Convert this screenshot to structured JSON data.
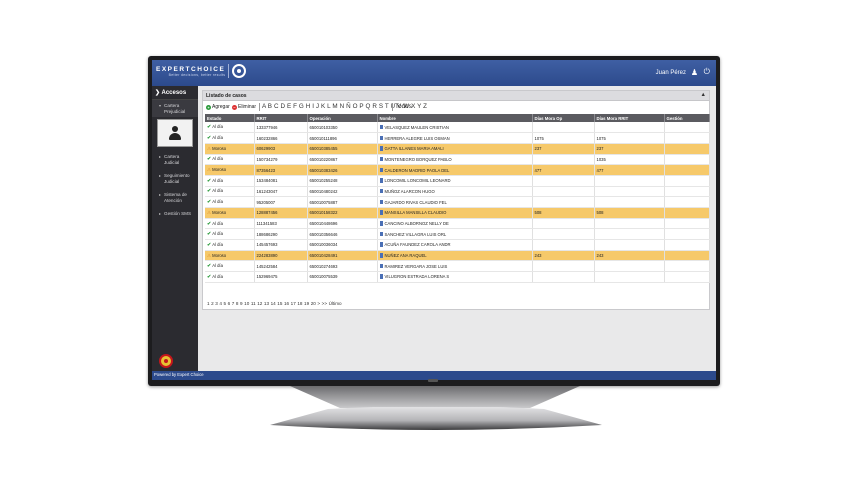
{
  "app": {
    "logo_text": "EXPERTCHOICE",
    "logo_sub": "Better decisions, better results",
    "user_name": "Juan Pérez"
  },
  "sidebar": {
    "header": "Accesos",
    "items": [
      {
        "label": "Cartera Prejudicial",
        "active": true
      },
      {
        "label": "Cartera Judicial",
        "active": false
      },
      {
        "label": "Seguimiento Judicial",
        "active": false
      },
      {
        "label": "Sistema de Atención",
        "active": false
      },
      {
        "label": "Gestión SMS",
        "active": false
      }
    ]
  },
  "footer": {
    "text": "Powered by Expert Choice"
  },
  "panel": {
    "title": "Listado de casos",
    "add_label": "Agregar",
    "delete_label": "Eliminar",
    "alphabet": "A B C D E F G H I J K L M N Ñ O P Q R S T U V W X Y Z",
    "all_label": "Todos"
  },
  "table": {
    "columns": [
      "Estado",
      "RRIT",
      "Operación",
      "Nombre",
      "Días Mora Op",
      "Días Mora RRIT",
      "Gestión"
    ],
    "rows": [
      {
        "estado": "Al día",
        "rrit": "133377946",
        "op": "650010103350",
        "nombre": "VELASQUEZ MAULEN CRISTIAN",
        "mora_op": "",
        "mora_rrit": "",
        "gestion": ""
      },
      {
        "estado": "Al día",
        "rrit": "160232866",
        "op": "650010111896",
        "nombre": "HERRERA ALEGRE LUIS OSMAN",
        "mora_op": "1075",
        "mora_rrit": "1075",
        "gestion": ""
      },
      {
        "estado": "Moroso",
        "rrit": "60629903",
        "op": "650010385455",
        "nombre": "GATTA ILLANES MARIA AMALI",
        "mora_op": "237",
        "mora_rrit": "237",
        "gestion": ""
      },
      {
        "estado": "Al día",
        "rrit": "150734279",
        "op": "650010220867",
        "nombre": "MONTENEGRO BORQUEZ PABLO",
        "mora_op": "",
        "mora_rrit": "1035",
        "gestion": ""
      },
      {
        "estado": "Moroso",
        "rrit": "87356423",
        "op": "650010383426",
        "nombre": "CALDERON MADRID PAOLA DEL",
        "mora_op": "477",
        "mora_rrit": "477",
        "gestion": ""
      },
      {
        "estado": "Al día",
        "rrit": "153484081",
        "op": "650010255248",
        "nombre": "LONCOMIL LONCOMIL LEONARD",
        "mora_op": "",
        "mora_rrit": "",
        "gestion": ""
      },
      {
        "estado": "Al día",
        "rrit": "161243047",
        "op": "650010480242",
        "nombre": "MUÑOZ ALARCON HUGO",
        "mora_op": "",
        "mora_rrit": "",
        "gestion": ""
      },
      {
        "estado": "Al día",
        "rrit": "95205007",
        "op": "650010075887",
        "nombre": "GAJARDO RIVAS CLAUDIO FEL",
        "mora_op": "",
        "mora_rrit": "",
        "gestion": ""
      },
      {
        "estado": "Moroso",
        "rrit": "128887456",
        "op": "650010158322",
        "nombre": "MANSILLA MANSILLA CLAUDIO",
        "mora_op": "508",
        "mora_rrit": "508",
        "gestion": ""
      },
      {
        "estado": "Al día",
        "rrit": "111341583",
        "op": "650010448696",
        "nombre": "CANCINO ALBORNOZ NELLY DE",
        "mora_op": "",
        "mora_rrit": "",
        "gestion": ""
      },
      {
        "estado": "Al día",
        "rrit": "188686290",
        "op": "650010356646",
        "nombre": "SANCHEZ VILLAGRA LUIS ORL",
        "mora_op": "",
        "mora_rrit": "",
        "gestion": ""
      },
      {
        "estado": "Al día",
        "rrit": "145457693",
        "op": "650010036034",
        "nombre": "ACUÑA FAUNDEZ CAROLA ANDR",
        "mora_op": "",
        "mora_rrit": "",
        "gestion": ""
      },
      {
        "estado": "Moroso",
        "rrit": "224283890",
        "op": "650010428491",
        "nombre": "NUÑEZ ANA RAQUEL",
        "mora_op": "243",
        "mora_rrit": "243",
        "gestion": ""
      },
      {
        "estado": "Al día",
        "rrit": "145242584",
        "op": "650010274693",
        "nombre": "RAMIREZ VERGARA JOSE LUIS",
        "mora_op": "",
        "mora_rrit": "",
        "gestion": ""
      },
      {
        "estado": "Al día",
        "rrit": "152969475",
        "op": "650010075539",
        "nombre": "VILUGRON ESTRADA LORENA S",
        "mora_op": "",
        "mora_rrit": "",
        "gestion": ""
      }
    ]
  },
  "pager": {
    "text": "1 2 3 4 5 6 7 8 9 10 11 12 13 14 15 16 17 18 19 20 > >> Último"
  },
  "colors": {
    "topbar": "#2c4a8c",
    "sidebar": "#2b2b30",
    "moroso_row": "#f6c96a",
    "header_row": "#5b5b60"
  }
}
